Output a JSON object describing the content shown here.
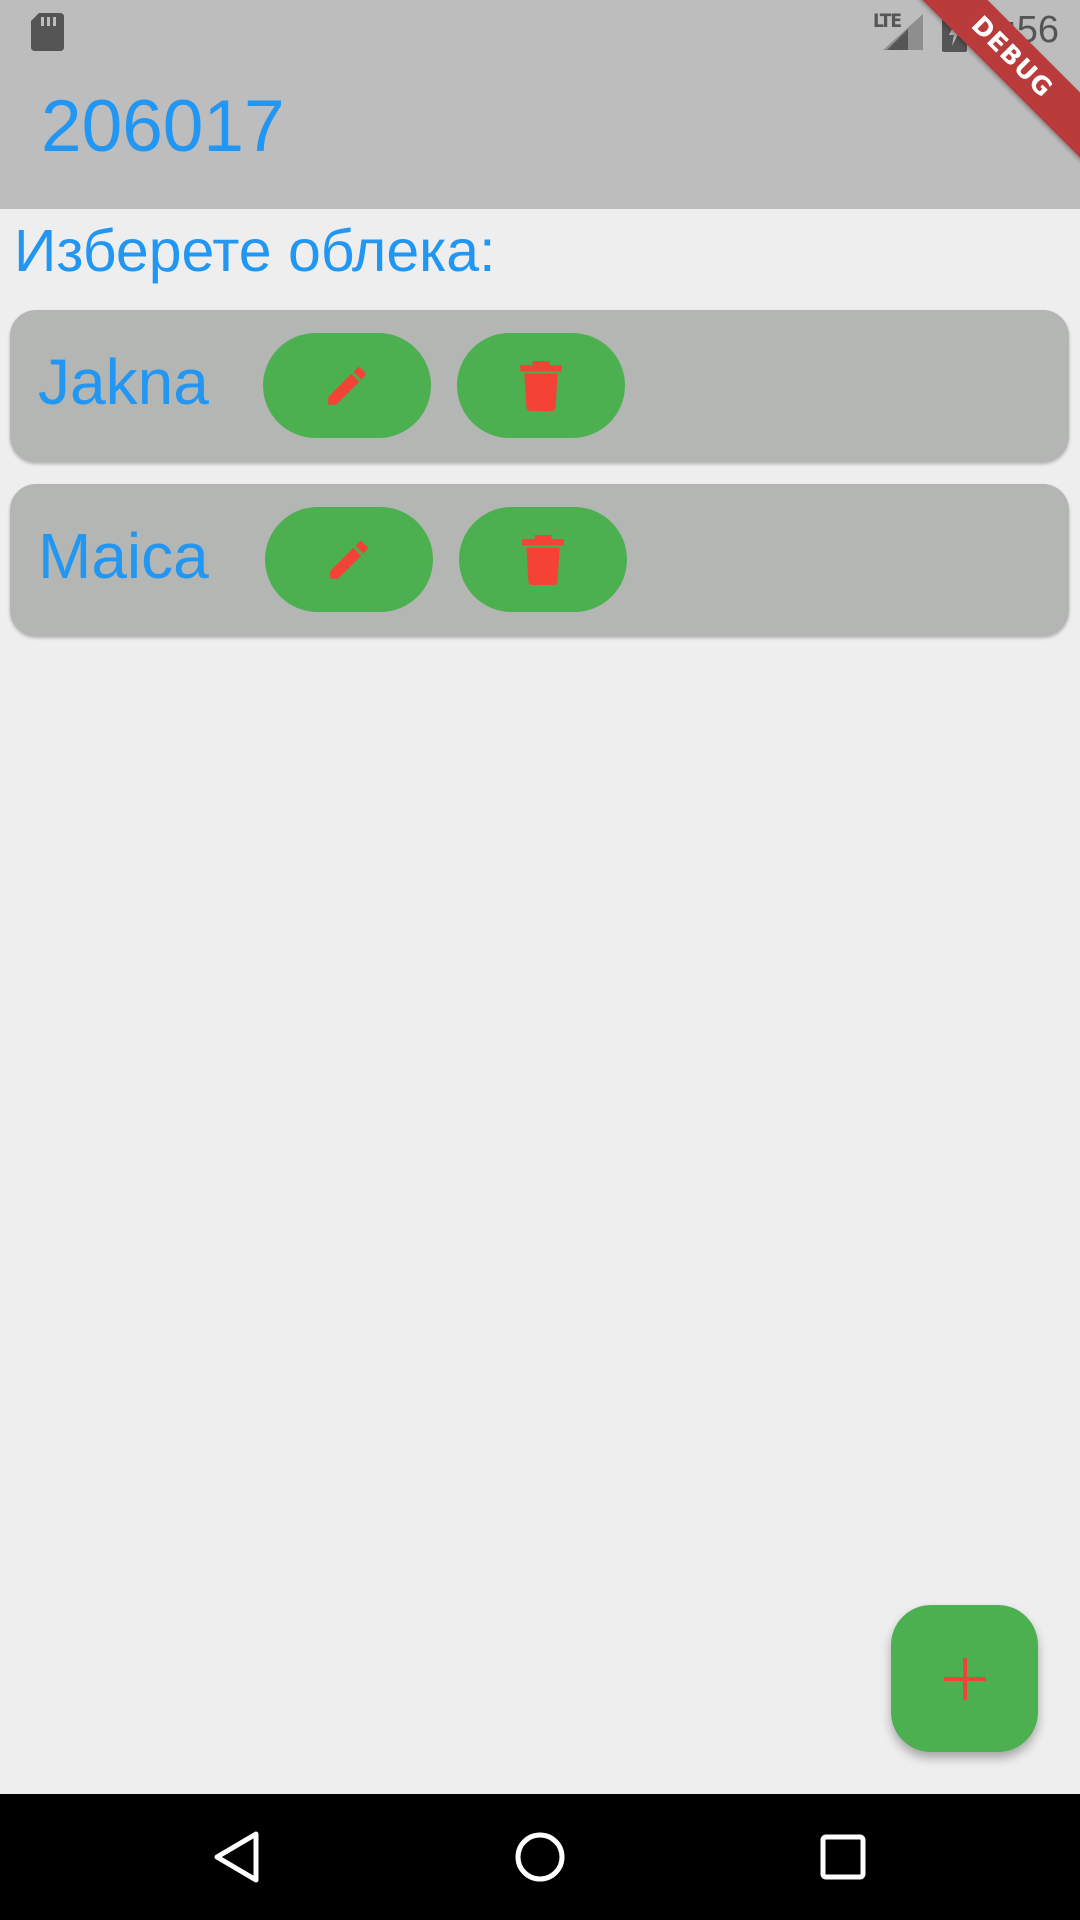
{
  "status_bar": {
    "network_label": "LTE",
    "time": "2:56"
  },
  "debug_banner": "DEBUG",
  "app_bar": {
    "title": "206017"
  },
  "prompt": "Изберете облека:",
  "items": [
    {
      "label": "Jakna",
      "edit_icon": "pencil-icon",
      "delete_icon": "trash-icon"
    },
    {
      "label": "Maica",
      "edit_icon": "pencil-icon",
      "delete_icon": "trash-icon"
    }
  ],
  "fab": {
    "icon": "plus-icon"
  },
  "navigation": {
    "back_icon": "back-triangle-icon",
    "home_icon": "home-circle-icon",
    "recents_icon": "recents-square-icon"
  },
  "colors": {
    "accent_text": "#2196f3",
    "button_green": "#4caf50",
    "icon_red": "#f44336",
    "card_gray": "#b3b6b3",
    "app_bar": "#bdbdbd",
    "background": "#eeeeee"
  }
}
